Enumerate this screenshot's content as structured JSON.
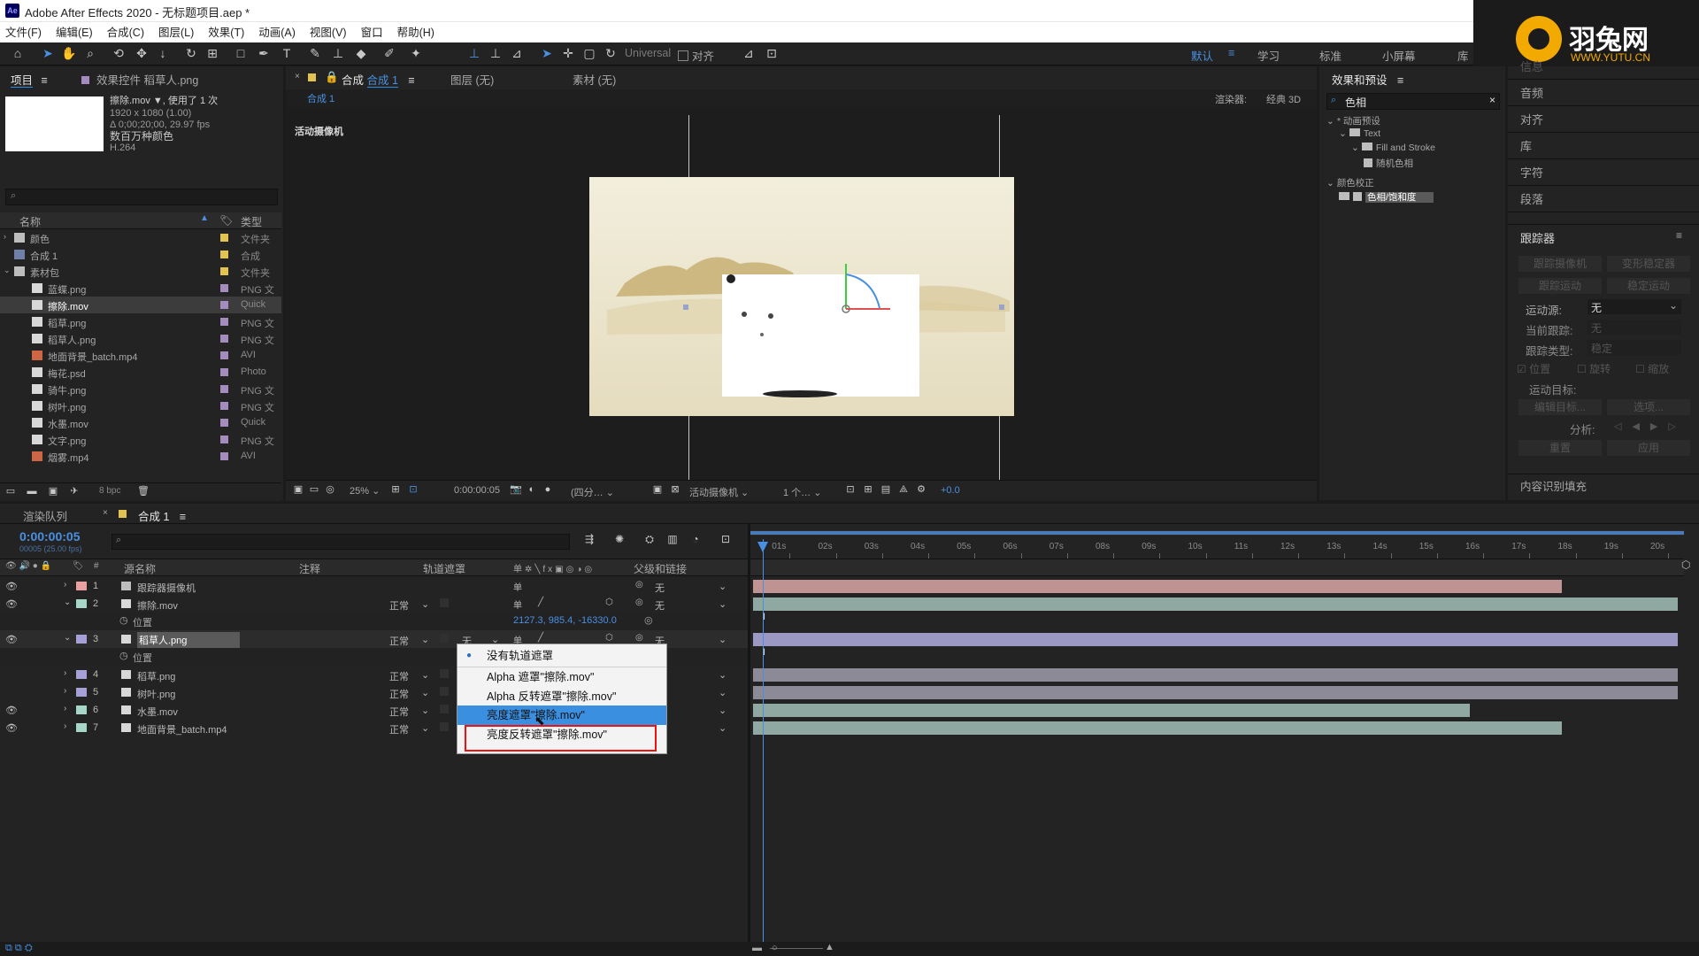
{
  "window": {
    "title": "Adobe After Effects 2020 - 无标题项目.aep *",
    "app_icon": "Ae"
  },
  "menu": [
    "文件(F)",
    "编辑(E)",
    "合成(C)",
    "图层(L)",
    "效果(T)",
    "动画(A)",
    "视图(V)",
    "窗口",
    "帮助(H)"
  ],
  "logo": {
    "cn": "羽兔网",
    "en": "WWW.YUTU.CN",
    "accent": "#f2a900"
  },
  "toolbar": {
    "universal_label": "Universal",
    "snap_label": "对齐",
    "workspaces": [
      "默认",
      "学习",
      "标准",
      "小屏幕",
      "库"
    ],
    "active_workspace": "默认"
  },
  "project": {
    "tab_project": "项目",
    "tab_effect_controls": "效果控件 稻草人.png",
    "asset_name": "擦除.mov ▼",
    "asset_usage": ", 使用了 1 次",
    "asset_info": [
      "1920 x 1080 (1.00)",
      "Δ 0;00;20;00, 29.97 fps",
      "数百万种颜色",
      "H.264"
    ],
    "col_name": "名称",
    "col_type": "类型",
    "items": [
      {
        "name": "颜色",
        "type": "文件夹",
        "color": "#e2c250",
        "kind": "folder",
        "indent": 0
      },
      {
        "name": "合成 1",
        "type": "合成",
        "color": "#e2c250",
        "kind": "comp",
        "indent": 0
      },
      {
        "name": "素材包",
        "type": "文件夹",
        "color": "#e2c250",
        "kind": "folder",
        "indent": 0
      },
      {
        "name": "蓝蝶.png",
        "type": "PNG 文",
        "color": "#a58cbf",
        "kind": "file",
        "indent": 1
      },
      {
        "name": "擦除.mov",
        "type": "Quick",
        "color": "#a58cbf",
        "kind": "movie",
        "indent": 1
      },
      {
        "name": "稻草.png",
        "type": "PNG 文",
        "color": "#a58cbf",
        "kind": "file",
        "indent": 1
      },
      {
        "name": "稻草人.png",
        "type": "PNG 文",
        "color": "#a58cbf",
        "kind": "file",
        "indent": 1
      },
      {
        "name": "地面背景_batch.mp4",
        "type": "AVI",
        "color": "#a58cbf",
        "kind": "video",
        "indent": 1
      },
      {
        "name": "梅花.psd",
        "type": "Photo",
        "color": "#a58cbf",
        "kind": "psd",
        "indent": 1
      },
      {
        "name": "骑牛.png",
        "type": "PNG 文",
        "color": "#a58cbf",
        "kind": "file",
        "indent": 1
      },
      {
        "name": "树叶.png",
        "type": "PNG 文",
        "color": "#a58cbf",
        "kind": "file",
        "indent": 1
      },
      {
        "name": "水墨.mov",
        "type": "Quick",
        "color": "#a58cbf",
        "kind": "movie",
        "indent": 1
      },
      {
        "name": "文字.png",
        "type": "PNG 文",
        "color": "#a58cbf",
        "kind": "file",
        "indent": 1
      },
      {
        "name": "烟雾.mp4",
        "type": "AVI",
        "color": "#a58cbf",
        "kind": "video",
        "indent": 1
      }
    ],
    "bpc": "8 bpc"
  },
  "viewer": {
    "tab_comp_prefix": "合成",
    "tab_comp_name": "合成 1",
    "tab_layer": "图层 (无)",
    "tab_footage": "素材 (无)",
    "sub_tab": "合成 1",
    "renderer_label": "渲染器:",
    "renderer_value": "经典 3D",
    "camera_label": "活动摄像机",
    "footer": {
      "zoom": "25%",
      "timecode": "0:00:00:05",
      "resolution": "(四分…",
      "camera": "活动摄像机",
      "views": "1 个…",
      "exposure": "+0.0"
    }
  },
  "effects": {
    "title": "效果和预设",
    "search_value": "色相",
    "tree": [
      {
        "label": "* 动画预设",
        "indent": 0
      },
      {
        "label": "Text",
        "indent": 1
      },
      {
        "label": "Fill and Stroke",
        "indent": 2
      },
      {
        "label": "随机色相",
        "indent": 3
      },
      {
        "label": "颜色校正",
        "indent": 0
      },
      {
        "label": "色相/饱和度",
        "indent": 1,
        "selected": true
      }
    ]
  },
  "right_panels": {
    "items": [
      "信息",
      "音频",
      "对齐",
      "库",
      "字符",
      "段落"
    ],
    "tracker_title": "跟踪器",
    "tracker_buttons": [
      "跟踪摄像机",
      "变形稳定器",
      "跟踪运动",
      "稳定运动"
    ],
    "motion_source_label": "运动源:",
    "motion_source_value": "无",
    "current_track_label": "当前跟踪:",
    "current_track_value": "无",
    "track_type_label": "跟踪类型:",
    "track_type_value": "稳定",
    "checks": [
      "位置",
      "旋转",
      "缩放"
    ],
    "motion_target_label": "运动目标:",
    "edit_target": "编辑目标...",
    "options": "选项...",
    "analyze_label": "分析:",
    "reset": "重置",
    "apply": "应用",
    "content_aware": "内容识别填充"
  },
  "timeline": {
    "tab_render": "渲染队列",
    "tab_comp": "合成 1",
    "timecode": "0:00:00:05",
    "frame_info": "00005 (25.00 fps)",
    "col_source": "源名称",
    "col_comment": "注释",
    "col_trackmatte": "轨道遮罩",
    "col_parent": "父级和链接",
    "ruler": [
      "01s",
      "02s",
      "03s",
      "04s",
      "05s",
      "06s",
      "07s",
      "08s",
      "09s",
      "10s",
      "11s",
      "12s",
      "13s",
      "14s",
      "15s",
      "16s",
      "17s",
      "18s",
      "19s",
      "20s"
    ],
    "layers": [
      {
        "n": "1",
        "name": "跟踪器摄像机",
        "color": "#e8a0a0",
        "mode": "",
        "parent": "无",
        "bar_color": "#c09393",
        "bar_end_sec": 17.5,
        "selected": false
      },
      {
        "n": "2",
        "name": "擦除.mov",
        "color": "#a5d6c8",
        "mode": "正常",
        "parent": "无",
        "bar_color": "#8fa8a2",
        "bar_end_sec": 20,
        "selected": false
      },
      {
        "n": "3",
        "name": "稻草人.png",
        "color": "#a5a0d6",
        "mode": "正常",
        "parent": "无",
        "bar_color": "#9b98c4",
        "bar_end_sec": 20,
        "selected": true
      },
      {
        "n": "4",
        "name": "稻草.png",
        "color": "#a5a0d6",
        "mode": "正常",
        "parent": "",
        "bar_color": "#8b8a96",
        "bar_end_sec": 20,
        "selected": false
      },
      {
        "n": "5",
        "name": "树叶.png",
        "color": "#a5a0d6",
        "mode": "正常",
        "parent": "",
        "bar_color": "#8b8a96",
        "bar_end_sec": 20,
        "selected": false
      },
      {
        "n": "6",
        "name": "水墨.mov",
        "color": "#a5d6c8",
        "mode": "正常",
        "parent": "",
        "bar_color": "#8fa8a2",
        "bar_end_sec": 15.5,
        "selected": false
      },
      {
        "n": "7",
        "name": "地面背景_batch.mp4",
        "color": "#a5d6c8",
        "mode": "正常",
        "parent": "",
        "bar_color": "#8fa8a2",
        "bar_end_sec": 17.5,
        "selected": false
      }
    ],
    "position_label": "位置",
    "position_value": "2127.3, 985.4, -16330.0",
    "trackmatte_value": "无"
  },
  "dropdown": {
    "items": [
      "没有轨道遮罩",
      "Alpha 遮罩\"擦除.mov\"",
      "Alpha 反转遮罩\"擦除.mov\"",
      "亮度遮罩\"擦除.mov\"",
      "亮度反转遮罩\"擦除.mov\""
    ],
    "checked_index": 0,
    "highlight_index": 3,
    "annotated_index": 4,
    "annotation_color": "#ee1111"
  }
}
